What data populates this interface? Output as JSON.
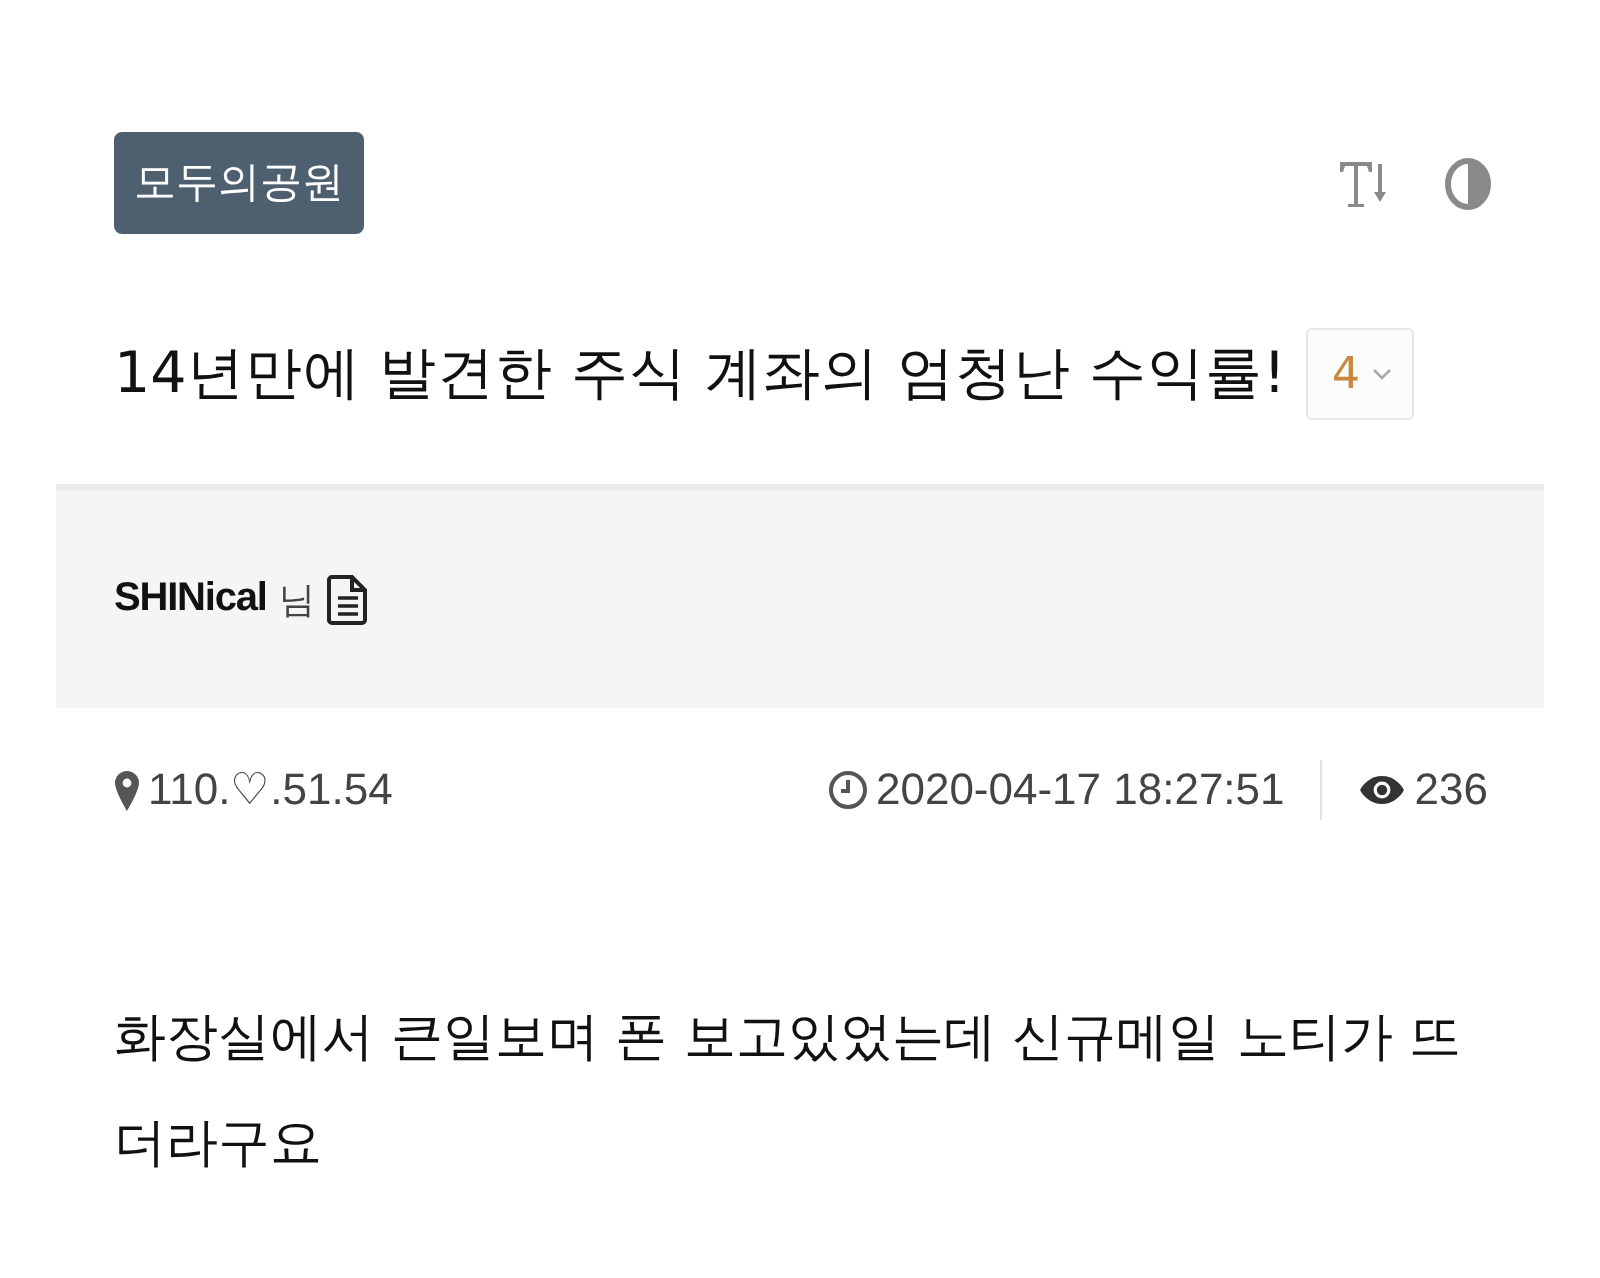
{
  "board_badge": "모두의공원",
  "post": {
    "title": "14년만에 발견한 주식 계좌의 엄청난 수익률!",
    "comment_count": "4"
  },
  "author": {
    "name": "SHINical",
    "suffix": "님"
  },
  "meta": {
    "ip": "110.♡.51.54",
    "datetime": "2020-04-17 18:27:51",
    "views": "236"
  },
  "body": "화장실에서 큰일보며 폰 보고있었는데 신규메일 노티가 뜨더라구요"
}
